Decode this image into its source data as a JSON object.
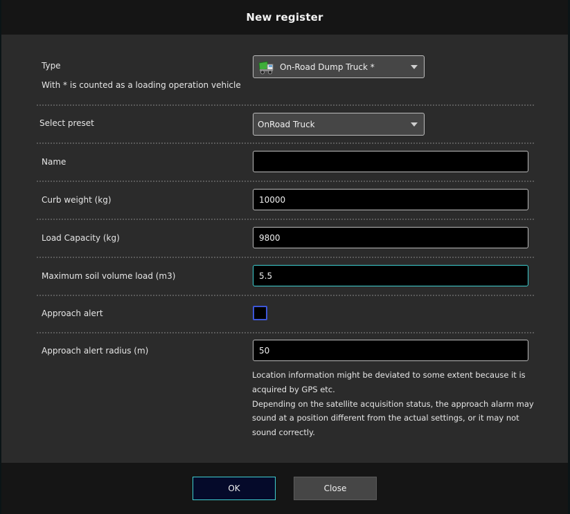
{
  "dialog": {
    "title": "New register"
  },
  "type_row": {
    "label": "Type",
    "hint": "With * is counted as a loading operation vehicle",
    "selected": "On-Road Dump Truck *",
    "icon": "dump-truck-icon"
  },
  "preset_row": {
    "label": "Select preset",
    "selected": "OnRoad Truck"
  },
  "name_row": {
    "label": "Name",
    "value": ""
  },
  "curb_row": {
    "label": "Curb weight (kg)",
    "value": "10000"
  },
  "load_row": {
    "label": "Load Capacity (kg)",
    "value": "9800"
  },
  "soil_row": {
    "label": "Maximum soil volume load (m3)",
    "value": "5.5"
  },
  "alert_row": {
    "label": "Approach alert",
    "checked": false
  },
  "radius_row": {
    "label": "Approach alert radius (m)",
    "value": "50",
    "note_line1": "Location information might be deviated to some extent because it is acquired by GPS etc.",
    "note_line2": "Depending on the satellite acquisition status, the approach alarm may sound at a position different from the actual settings, or it may not sound correctly."
  },
  "buttons": {
    "ok": "OK",
    "close": "Close"
  },
  "colors": {
    "focus_accent": "#3fd0d2",
    "checkbox_border": "#3d56d8",
    "ok_background": "#050a2a"
  }
}
